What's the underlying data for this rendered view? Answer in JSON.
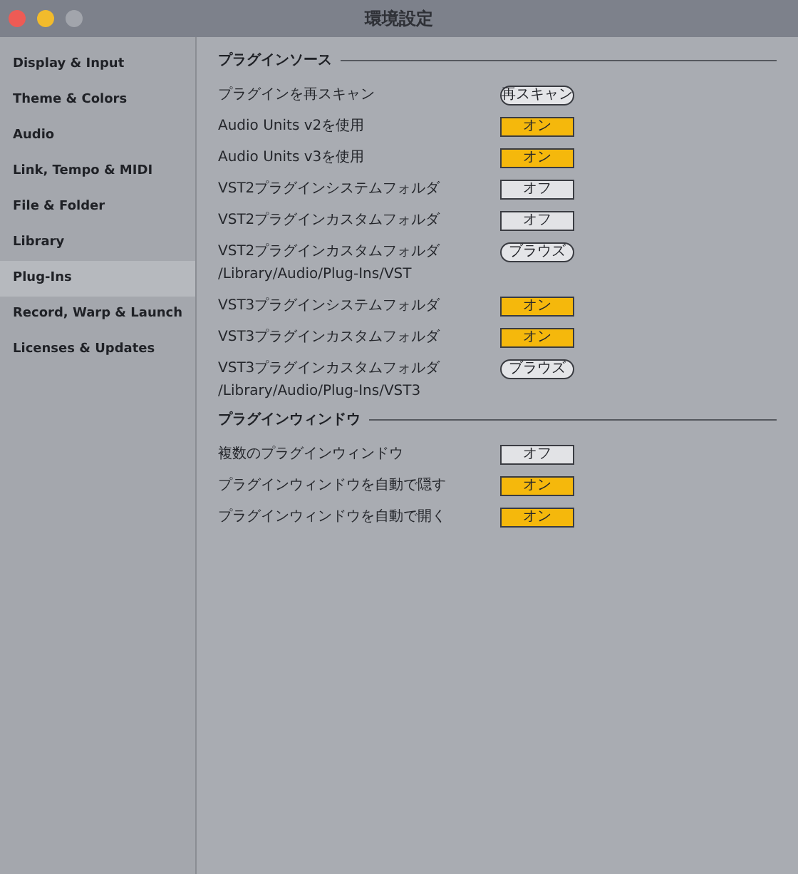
{
  "window": {
    "title": "環境設定"
  },
  "sidebar": {
    "items": [
      {
        "label": "Display & Input",
        "selected": false
      },
      {
        "label": "Theme & Colors",
        "selected": false
      },
      {
        "label": "Audio",
        "selected": false
      },
      {
        "label": "Link, Tempo & MIDI",
        "selected": false
      },
      {
        "label": "File & Folder",
        "selected": false
      },
      {
        "label": "Library",
        "selected": false
      },
      {
        "label": "Plug-Ins",
        "selected": true
      },
      {
        "label": "Record, Warp & Launch",
        "selected": false
      },
      {
        "label": "Licenses & Updates",
        "selected": false
      }
    ]
  },
  "sections": [
    {
      "title": "プラグインソース",
      "rows": [
        {
          "kind": "button",
          "label": "プラグインを再スキャン",
          "button": "再スキャン"
        },
        {
          "kind": "toggle",
          "label": "Audio Units v2を使用",
          "value": "オン",
          "on": true
        },
        {
          "kind": "toggle",
          "label": "Audio Units v3を使用",
          "value": "オン",
          "on": true
        },
        {
          "kind": "toggle",
          "label": "VST2プラグインシステムフォルダ",
          "value": "オフ",
          "on": false
        },
        {
          "kind": "toggle",
          "label": "VST2プラグインカスタムフォルダ",
          "value": "オフ",
          "on": false
        },
        {
          "kind": "button",
          "label": "VST2プラグインカスタムフォルダ",
          "button": "ブラウズ",
          "path": "/Library/Audio/Plug-Ins/VST"
        },
        {
          "kind": "toggle",
          "label": "VST3プラグインシステムフォルダ",
          "value": "オン",
          "on": true
        },
        {
          "kind": "toggle",
          "label": "VST3プラグインカスタムフォルダ",
          "value": "オン",
          "on": true
        },
        {
          "kind": "button",
          "label": "VST3プラグインカスタムフォルダ",
          "button": "ブラウズ",
          "path": "/Library/Audio/Plug-Ins/VST3"
        }
      ]
    },
    {
      "title": "プラグインウィンドウ",
      "rows": [
        {
          "kind": "toggle",
          "label": "複数のプラグインウィンドウ",
          "value": "オフ",
          "on": false
        },
        {
          "kind": "toggle",
          "label": "プラグインウィンドウを自動で隠す",
          "value": "オン",
          "on": true
        },
        {
          "kind": "toggle",
          "label": "プラグインウィンドウを自動で開く",
          "value": "オン",
          "on": true
        }
      ]
    }
  ]
}
